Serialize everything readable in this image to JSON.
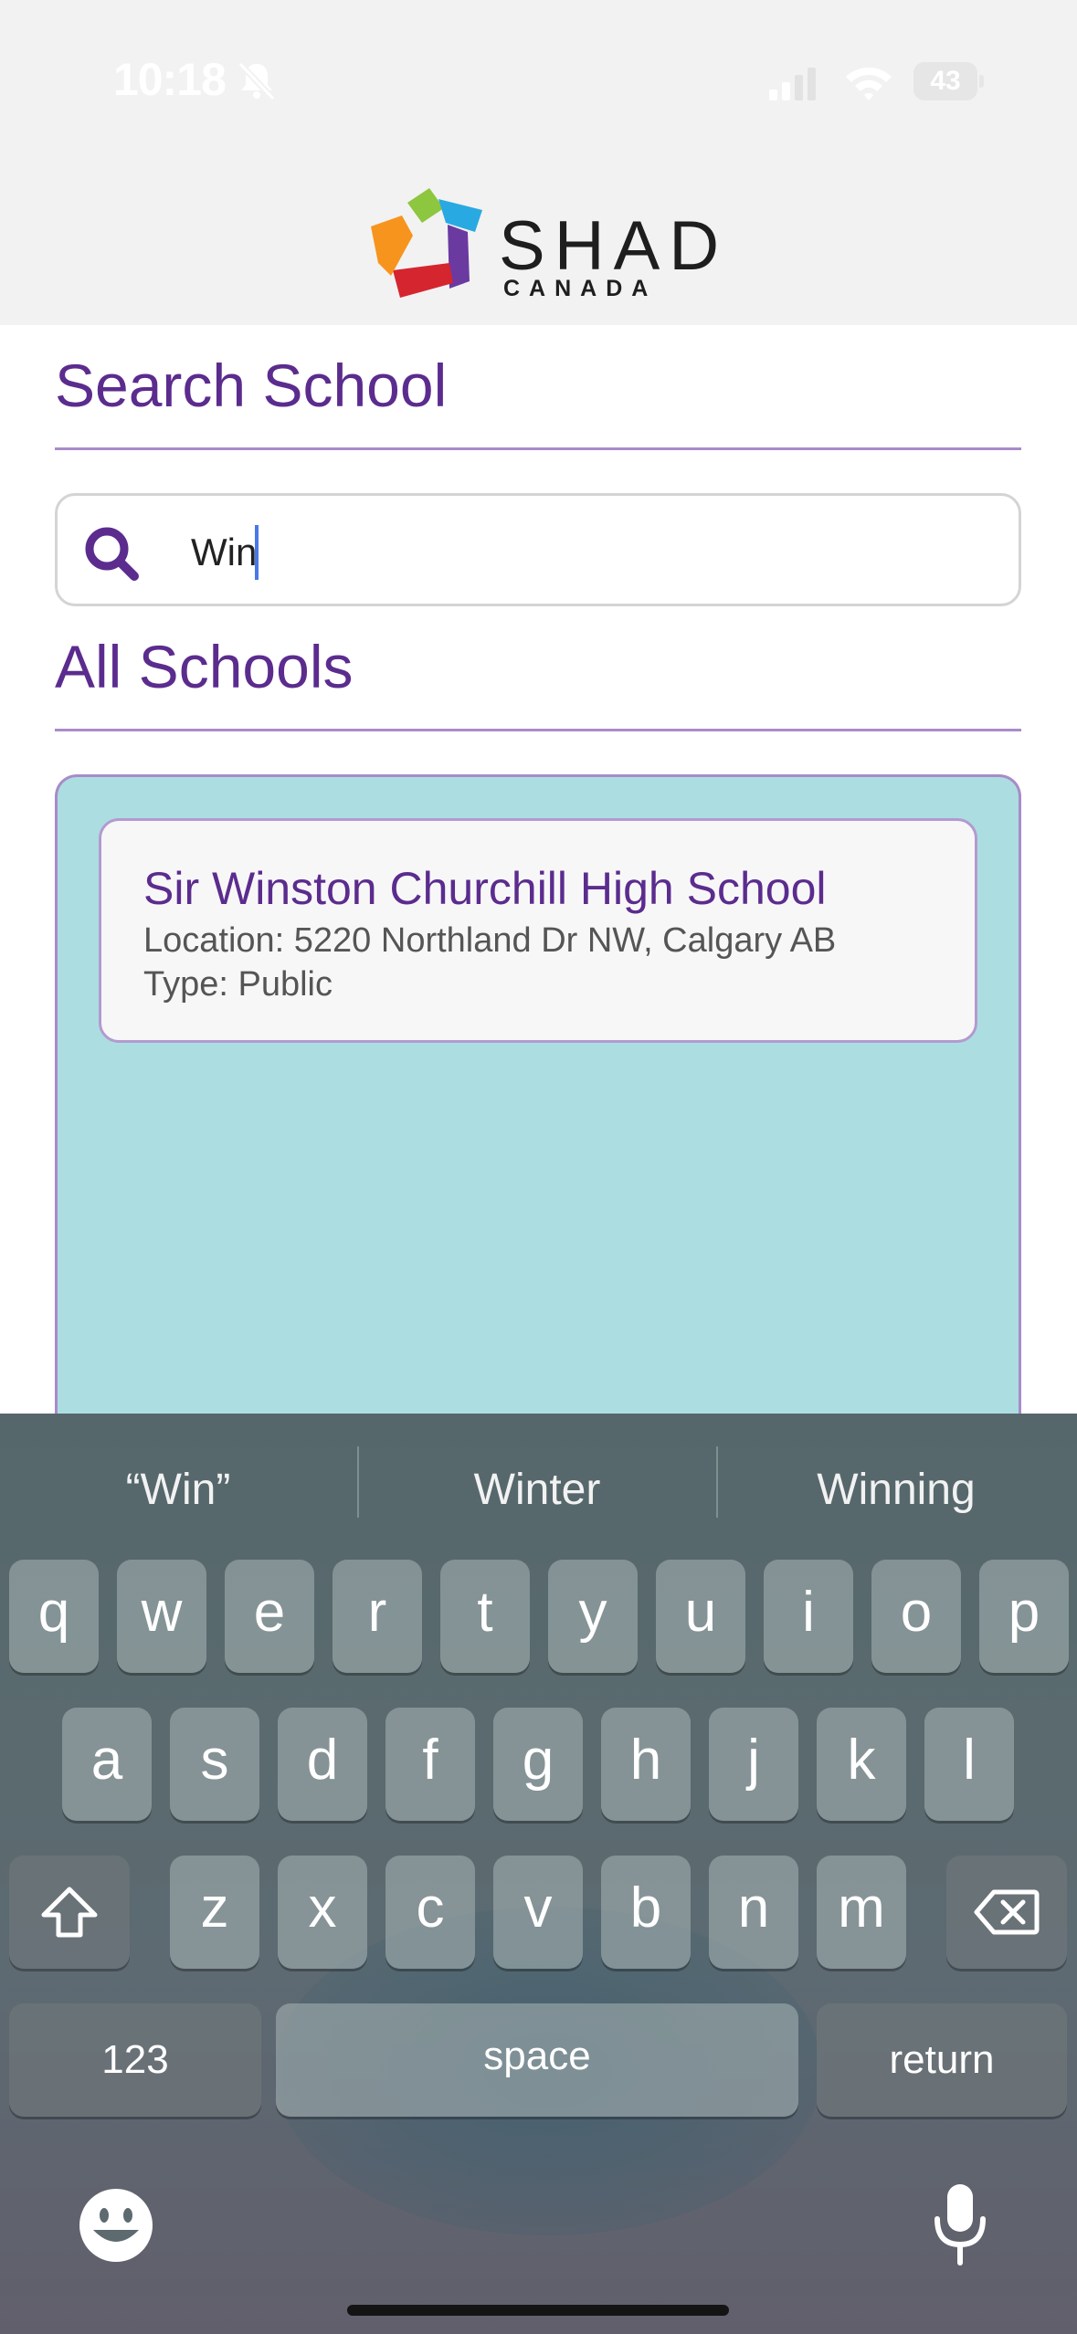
{
  "status_bar": {
    "time": "10:18",
    "battery": "43",
    "icons": [
      "bell-slash-icon",
      "signal-icon",
      "wifi-icon",
      "battery-icon"
    ]
  },
  "brand": {
    "name": "SHAD",
    "sub": "CANADA",
    "logo_colors": [
      "#8dc63f",
      "#29a9e1",
      "#6a3aa0",
      "#d5252f",
      "#f7941d"
    ]
  },
  "search_section": {
    "title": "Search School",
    "query": "Win",
    "icon": "search-icon"
  },
  "results_section": {
    "title": "All Schools",
    "schools": [
      {
        "name": "Sir Winston Churchill High School",
        "location": "Location: 5220 Northland Dr NW, Calgary AB",
        "type": "Type: Public"
      }
    ]
  },
  "keyboard": {
    "suggestions": [
      "“Win”",
      "Winter",
      "Winning"
    ],
    "row1": [
      "q",
      "w",
      "e",
      "r",
      "t",
      "y",
      "u",
      "i",
      "o",
      "p"
    ],
    "row2": [
      "a",
      "s",
      "d",
      "f",
      "g",
      "h",
      "j",
      "k",
      "l"
    ],
    "row3": [
      "z",
      "x",
      "c",
      "v",
      "b",
      "n",
      "m"
    ],
    "numbers_label": "123",
    "space_label": "space",
    "return_label": "return"
  },
  "colors": {
    "accent_purple": "#5b2c8e",
    "results_bg": "#acdee1",
    "caret": "#4a78e6"
  }
}
